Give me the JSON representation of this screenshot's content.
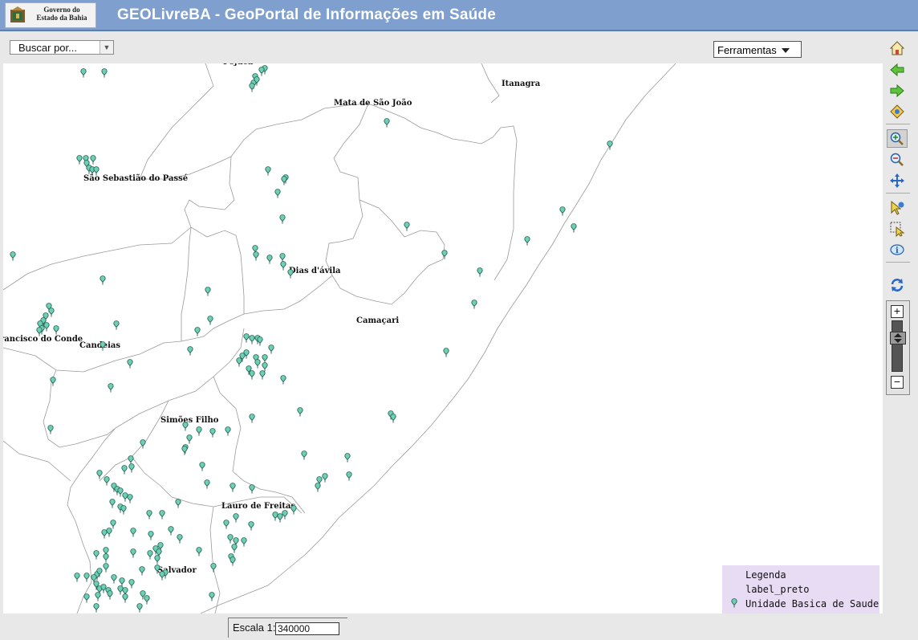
{
  "header": {
    "logo_text": "Governo do Estado da Bahia",
    "title": "GEOLivreBA - GeoPortal de Informações em Saúde"
  },
  "topbar": {
    "search_select": "Buscar por...",
    "tools_menu": "Ferramentas"
  },
  "map": {
    "places": [
      "Itanagra",
      "Mata de São João",
      "São Sebastião do Passé",
      "Dias d'ávila",
      "Camaçari",
      "rancisco do Conde",
      "Candeias",
      "Simões Filho",
      "Lauro de Freitas",
      "Salvador"
    ],
    "marker_color": "#6fcfb4"
  },
  "legend": {
    "title": "Legenda",
    "layer1": "label_preto",
    "layer2": "Unidade Basica de Saude"
  },
  "toolbar": {
    "tools": [
      "home-icon",
      "back-icon",
      "forward-icon",
      "full-extent-icon",
      "zoom-in-icon",
      "zoom-out-icon",
      "pan-icon",
      "identify-icon",
      "select-icon",
      "info-icon",
      "refresh-icon"
    ],
    "active_tool": "zoom-in-icon"
  },
  "bottombar": {
    "scale_label": "Escala 1:",
    "scale_value": "340000"
  }
}
